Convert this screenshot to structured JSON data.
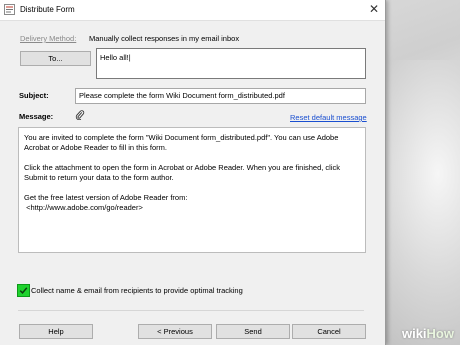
{
  "window": {
    "title": "Distribute Form",
    "close_glyph": "✕"
  },
  "delivery": {
    "label": "Delivery Method:",
    "value": "Manually collect responses in my email inbox"
  },
  "to": {
    "button_label": "To...",
    "value": "Hello all!|"
  },
  "subject": {
    "label": "Subject:",
    "value": "Please complete the form Wiki Document form_distributed.pdf"
  },
  "message": {
    "label": "Message:",
    "reset_link": "Reset default message",
    "attach_icon": "paperclip-icon",
    "body": "You are invited to complete the form \"Wiki Document form_distributed.pdf\". You can use Adobe Acrobat or Adobe Reader to fill in this form.\n\nClick the attachment to open the form in Acrobat or Adobe Reader. When you are finished, click Submit to return your data to the form author.\n\nGet the free latest version of Adobe Reader from:\n <http://www.adobe.com/go/reader>"
  },
  "collect": {
    "checked": true,
    "label": "Collect name & email from recipients to provide optimal tracking"
  },
  "buttons": {
    "help": "Help",
    "previous": "< Previous",
    "send": "Send",
    "cancel": "Cancel"
  },
  "watermark": {
    "wiki": "wiki",
    "how": "How"
  },
  "colors": {
    "accent_check": "#1fd22e",
    "link": "#1a4fd0"
  }
}
